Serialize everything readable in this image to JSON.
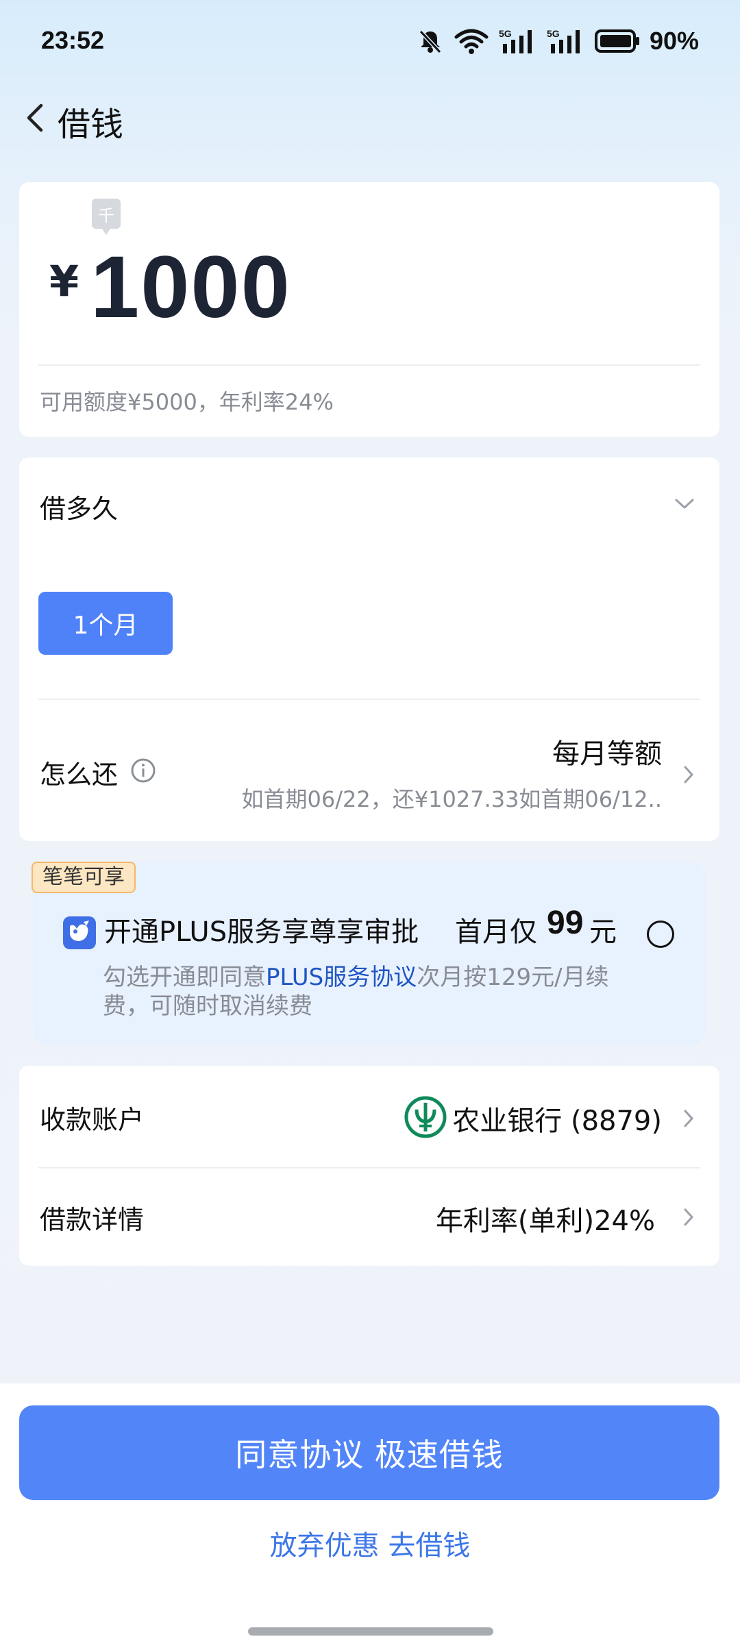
{
  "status_bar": {
    "time": "23:52",
    "battery": "90%",
    "network_labels": [
      "5G",
      "5G"
    ]
  },
  "header": {
    "title": "借钱"
  },
  "amount_card": {
    "unit_tag": "千",
    "currency": "¥",
    "amount": "1000",
    "quota_info": "可用额度¥5000，年利率24%"
  },
  "term_card": {
    "term_label": "借多久",
    "selected_term": "1个月",
    "repay_label": "怎么还",
    "repay_method": "每月等额",
    "repay_detail": "如首期06/22，还¥1027.33如首期06/12.."
  },
  "promo": {
    "badge": "笔笔可享",
    "title": "开通PLUS服务享尊享审批",
    "price_prefix": "首月仅",
    "price_number": "99",
    "price_unit": "元",
    "desc_before": "勾选开通即同意",
    "desc_link": "PLUS服务协议",
    "desc_after": "次月按129元/月续费，可随时取消续费"
  },
  "account_card": {
    "account_label": "收款账户",
    "bank": "农业银行 (8879)",
    "detail_label": "借款详情",
    "rate": "年利率(单利)24%"
  },
  "actions": {
    "primary": "同意协议 极速借钱",
    "secondary": "放弃优惠 去借钱"
  },
  "colors": {
    "accent": "#4f82f8",
    "link": "#1f55c4",
    "bank_green": "#0f8a5a",
    "badge_bg": "#fde7c2"
  }
}
